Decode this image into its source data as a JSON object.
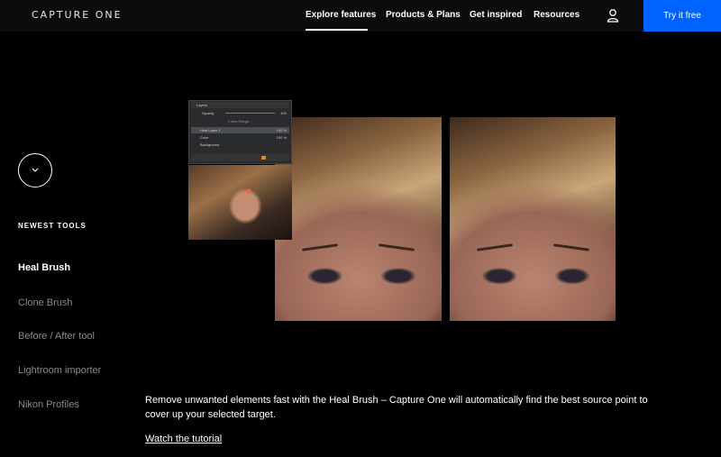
{
  "header": {
    "logo": "CAPTURE ONE",
    "nav": [
      {
        "label": "Explore features",
        "active": true
      },
      {
        "label": "Products & Plans",
        "active": false
      },
      {
        "label": "Get inspired",
        "active": false
      },
      {
        "label": "Resources",
        "active": false
      }
    ],
    "user_icon": "user-icon",
    "cta_label": "Try it free",
    "cta_color": "#0062ff"
  },
  "sidebar": {
    "toggle_icon": "chevron-down-icon",
    "heading": "NEWEST TOOLS",
    "items": [
      {
        "label": "Heal Brush",
        "active": true
      },
      {
        "label": "Clone Brush",
        "active": false
      },
      {
        "label": "Before / After tool",
        "active": false
      },
      {
        "label": "Lightroom importer",
        "active": false
      },
      {
        "label": "Nikon Profiles",
        "active": false
      }
    ]
  },
  "layers_panel": {
    "title": "Layers",
    "opacity_label": "Opacity",
    "opacity_value": "100",
    "clone_range_label": "Luma Range...",
    "layers": [
      {
        "name": "Heal Layer 1",
        "opacity": "100 %",
        "selected": true
      },
      {
        "name": "Color",
        "opacity": "100 %",
        "selected": false
      },
      {
        "name": "Background",
        "opacity": "",
        "selected": false
      }
    ]
  },
  "main": {
    "description": "Remove unwanted elements fast with the Heal Brush – Capture One will automatically find the best source point to cover up your selected target.",
    "link_label": "Watch the tutorial"
  }
}
